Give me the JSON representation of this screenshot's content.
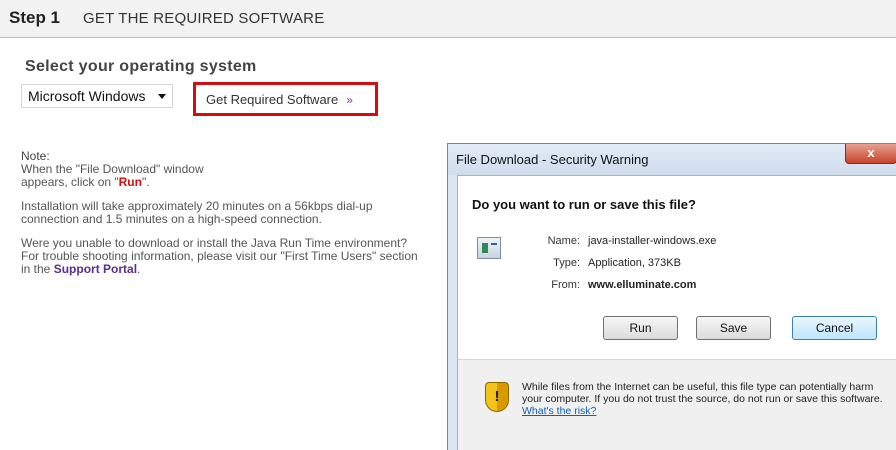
{
  "header": {
    "step_label": "Step 1",
    "title": "GET THE REQUIRED SOFTWARE"
  },
  "os": {
    "heading": "Select your operating system",
    "selected": "Microsoft Windows",
    "get_button_label": "Get Required Software",
    "get_button_arrows": "»"
  },
  "notes": {
    "note_label": "Note:",
    "line1": "When the \"File Download\" window",
    "line2_prefix": "appears, click on \"",
    "run_word": "Run",
    "line2_suffix": "\".",
    "install_text": "Installation will take approximately 20 minutes on a 56kbps dial-up connection and 1.5 minutes on a high-speed connection.",
    "unable_text": "Were you unable to download or install the Java Run Time environment? For trouble shooting information, please visit our \"First Time Users\" section in the ",
    "support_portal": "Support Portal",
    "period": "."
  },
  "dialog": {
    "title": "File Download - Security Warning",
    "close_label": "x",
    "question": "Do you want to run or save this file?",
    "name_label": "Name:",
    "name_value": "java-installer-windows.exe",
    "type_label": "Type:",
    "type_value": "Application, 373KB",
    "from_label": "From:",
    "from_value": "www.elluminate.com",
    "run_button": "Run",
    "save_button": "Save",
    "cancel_button": "Cancel",
    "warning_text": "While files from the Internet can be useful, this file type can potentially harm your computer. If you do not trust the source, do not run or save this software. ",
    "risk_link": "What's the risk?",
    "shield_glyph": "!"
  },
  "colors": {
    "accent_red": "#d40d12",
    "link_purple": "#5b2d8b",
    "dialog_blue": "#dbe6f3"
  }
}
